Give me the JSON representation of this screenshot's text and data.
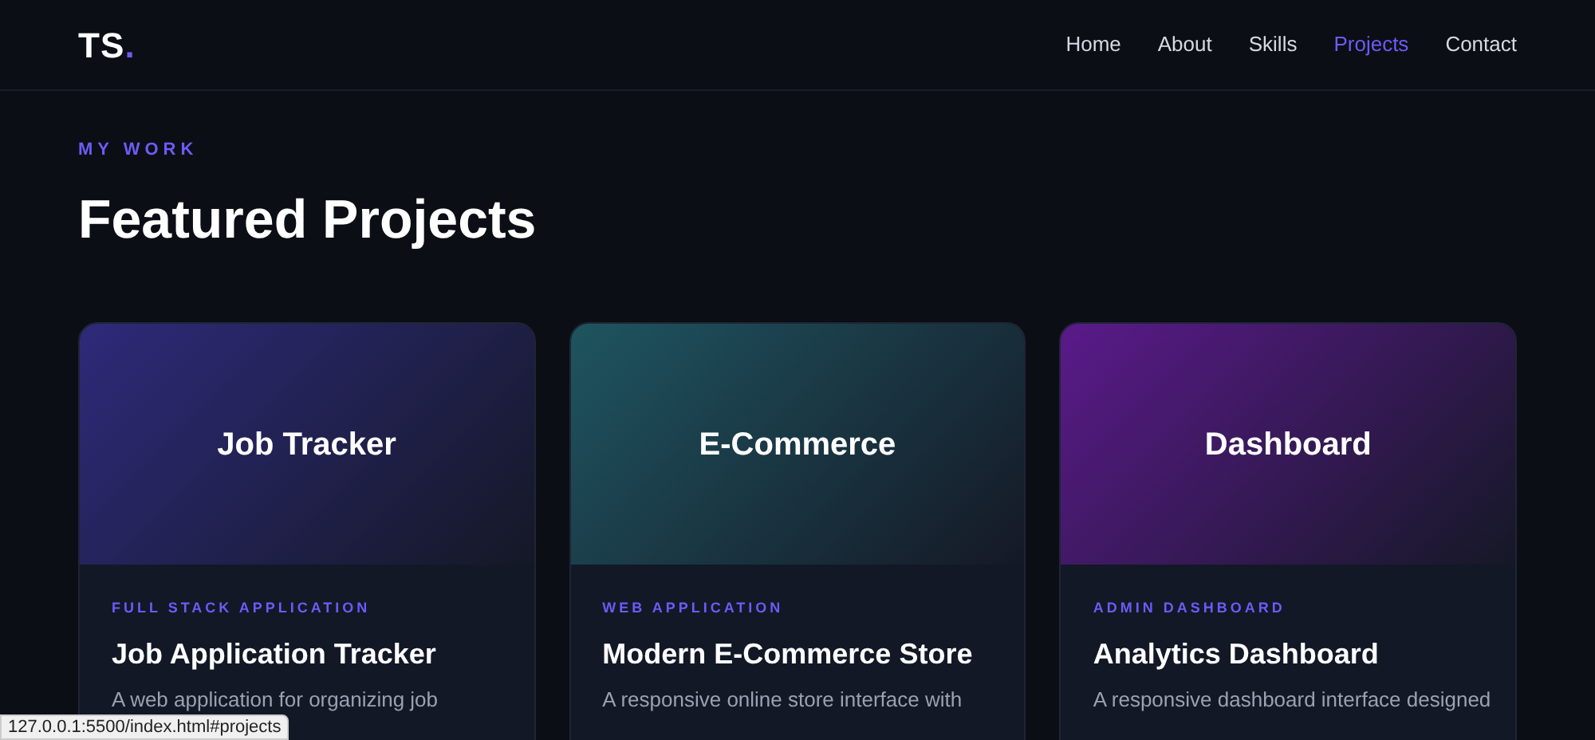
{
  "logo": {
    "text": "TS",
    "dot": "."
  },
  "nav": [
    {
      "label": "Home",
      "selected": false
    },
    {
      "label": "About",
      "selected": false
    },
    {
      "label": "Skills",
      "selected": false
    },
    {
      "label": "Projects",
      "selected": true
    },
    {
      "label": "Contact",
      "selected": false
    }
  ],
  "section": {
    "eyebrow": "MY WORK",
    "heading": "Featured Projects"
  },
  "projects": [
    {
      "banner": "Job Tracker",
      "color": "#2e2a7a",
      "tag": "FULL STACK APPLICATION",
      "title": "Job Application Tracker",
      "lines": [
        "A web application for organizing job"
      ]
    },
    {
      "banner": "E-Commerce",
      "color": "#1e5560",
      "tag": "WEB APPLICATION",
      "title": "Modern E-Commerce Store",
      "lines": [
        "A responsive online store interface with"
      ]
    },
    {
      "banner": "Dashboard",
      "color": "#5a1a8a",
      "tag": "ADMIN DASHBOARD",
      "title": "Analytics Dashboard",
      "lines": [
        "A responsive dashboard interface designed"
      ]
    }
  ],
  "status_url": "127.0.0.1:5500/index.html#projects"
}
